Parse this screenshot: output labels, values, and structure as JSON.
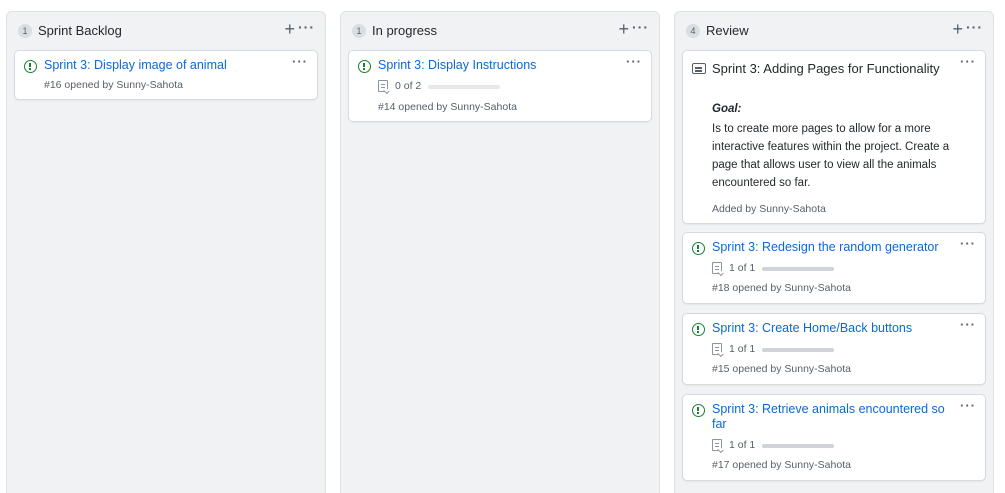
{
  "columns": [
    {
      "count": "1",
      "title": "Sprint Backlog",
      "add_icon": "+",
      "more_icon": "···",
      "cards": [
        {
          "type": "issue",
          "icon": "issue-opened-icon",
          "title": "Sprint 3: Display image of animal",
          "meta_prefix": "#16 opened by ",
          "user": "Sunny-Sahota"
        }
      ]
    },
    {
      "count": "1",
      "title": "In progress",
      "add_icon": "+",
      "more_icon": "···",
      "cards": [
        {
          "type": "issue",
          "icon": "issue-opened-icon",
          "title": "Sprint 3: Display Instructions",
          "progress_text": "0 of 2",
          "progress": 0,
          "meta_prefix": "#14 opened by ",
          "user": "Sunny-Sahota"
        }
      ]
    },
    {
      "count": "4",
      "title": "Review",
      "add_icon": "+",
      "more_icon": "···",
      "cards": [
        {
          "type": "note",
          "icon": "note-icon",
          "title": "Sprint 3: Adding Pages for Functionality",
          "goal_label": "Goal:",
          "body": "Is to create more pages to allow for a more interactive features within the project. Create a page that allows user to view all the animals encountered so far.",
          "meta_prefix": "Added by ",
          "user": "Sunny-Sahota"
        },
        {
          "type": "issue",
          "icon": "issue-opened-icon",
          "title": "Sprint 3: Redesign the random generator",
          "progress_text": "1 of 1",
          "progress": 1,
          "meta_prefix": "#18 opened by ",
          "user": "Sunny-Sahota"
        },
        {
          "type": "issue",
          "icon": "issue-opened-icon",
          "title": "Sprint 3: Create Home/Back buttons",
          "progress_text": "1 of 1",
          "progress": 1,
          "meta_prefix": "#15 opened by ",
          "user": "Sunny-Sahota"
        },
        {
          "type": "issue",
          "icon": "issue-opened-icon",
          "title": "Sprint 3: Retrieve animals encountered so far",
          "progress_text": "1 of 1",
          "progress": 1,
          "meta_prefix": "#17 opened by ",
          "user": "Sunny-Sahota"
        }
      ]
    }
  ],
  "colors": {
    "link": "#0969da",
    "issue_open": "#1a7f37",
    "column_bg": "#f0f2f4"
  }
}
